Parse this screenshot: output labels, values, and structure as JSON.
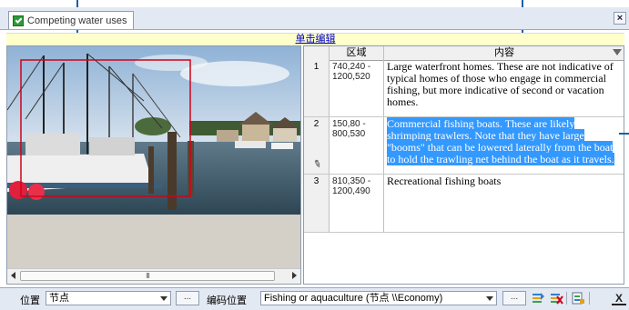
{
  "tab": {
    "label": "Competing water uses",
    "icon": "map-annotation-icon"
  },
  "edit_bar": {
    "link": "单击编辑"
  },
  "grid": {
    "headers": {
      "num": "",
      "region": "区域",
      "content": "内容"
    },
    "rows": [
      {
        "num": "1",
        "region": "740,240 - 1200,520",
        "content": "Large waterfront homes. These are not indicative of typical homes of those who engage in commercial fishing, but more indicative of second or vacation homes."
      },
      {
        "num": "2",
        "region": "150,80 - 800,530",
        "content": "Commercial fishing boats. These are likely shrimping trawlers. Note that they have large \"booms\" that can be lowered laterally from the boat to hold the trawling net behind the boat as it travels."
      },
      {
        "num": "3",
        "region": "810,350 - 1200,490",
        "content": "Recreational fishing boats"
      }
    ]
  },
  "scrollbar": {
    "thumb_grip": "III"
  },
  "bottom_bar": {
    "position_label": "位置",
    "position_value": "节点",
    "ellipsis": "...",
    "coding_label": "编码位置",
    "coding_value": "Fishing or aquaculture (节点 \\\\Economy)",
    "close": "X"
  },
  "colors": {
    "accent": "#1a5fa8",
    "selection": "#3399ff",
    "highlight_box": "#d0021b",
    "edit_bar": "#ffffcc"
  }
}
